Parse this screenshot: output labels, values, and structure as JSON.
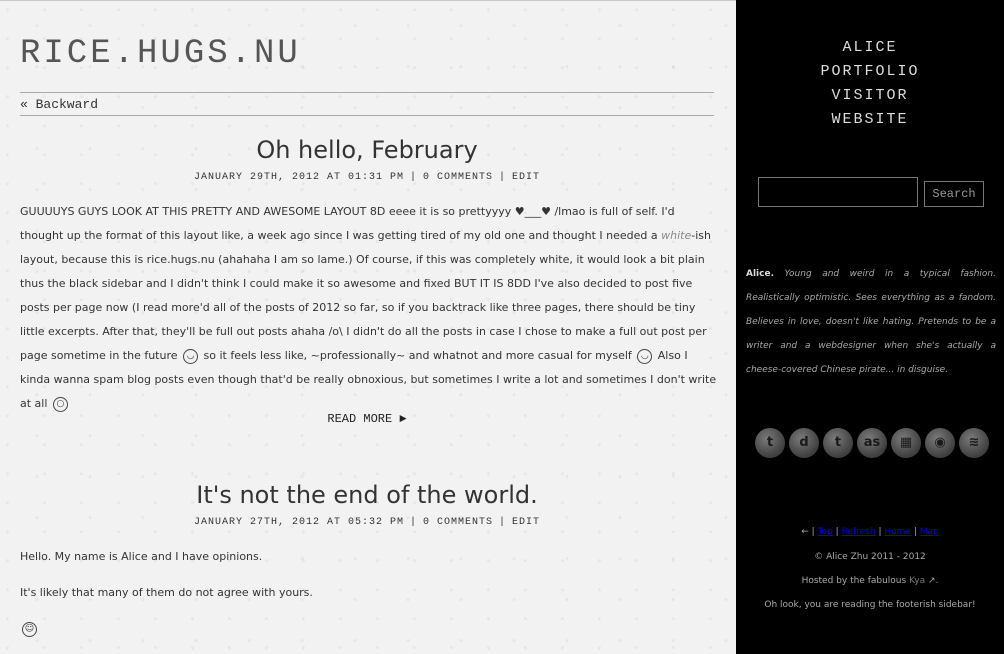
{
  "header": {
    "site_title": "RICE.HUGS.NU",
    "backward_link": "« Backward"
  },
  "posts": [
    {
      "title": "Oh hello, February",
      "date": "JANUARY 29TH, 2012 AT 01:31 PM",
      "comments": "0 COMMENTS",
      "edit": "EDIT",
      "body_part1": "GUUUUYS GUYS LOOK AT THIS PRETTY AND AWESOME LAYOUT 8D eeee it is so prettyyyy ♥___♥ /lmao is full of self. I'd thought up the format of this layout like, a week ago since I was getting tired of my old one and thought I needed a ",
      "body_em": "white",
      "body_part2": "-ish layout, because this is rice.hugs.nu (ahahaha I am so lame.) Of course, if this was completely white, it would look a bit plain thus the black sidebar and I didn't think I could make it so awesome and fixed BUT IT IS 8DD I've also decided to post five posts per page now (I read more'd all of the posts of 2012 so far, so if you backtrack like three pages, there should be tiny little excerpts. After that, they'll be full out posts ahaha /o\\ I didn't do all the posts in case I chose to make a full out post per page sometime in the future ",
      "body_part3": " so it feels less like, ~professionally~ and whatnot and more casual for myself ",
      "body_part4": " Also I kinda wanna spam blog posts even though that'd be really obnoxious, but sometimes I write a lot and sometimes I don't write at all ",
      "read_more": "READ MORE ►"
    },
    {
      "title": "It's not the end of the world.",
      "date": "JANUARY 27TH, 2012 AT 05:32 PM",
      "comments": "0 COMMENTS",
      "edit": "EDIT",
      "para1": "Hello. My name is Alice and I have opinions.",
      "para2": "It's likely that many of them do not agree with yours."
    }
  ],
  "sidebar": {
    "nav": [
      "ALICE",
      "PORTFOLIO",
      "VISITOR",
      "WEBSITE"
    ],
    "search_button": "Search",
    "about_name": "Alice.",
    "about_text": " Young and weird in a typical fashion. Realistically optimistic. Sees everything as a fandom. Believes in love, doesn't like hating. Pretends to be a writer and a webdesigner when she's actually a cheese-covered Chinese pirate... in disguise.",
    "social_icons": [
      {
        "name": "twitter-icon",
        "glyph": "t"
      },
      {
        "name": "deviantart-icon",
        "glyph": "d"
      },
      {
        "name": "tumblr-icon",
        "glyph": "t"
      },
      {
        "name": "lastfm-icon",
        "glyph": "as"
      },
      {
        "name": "windows-icon",
        "glyph": "▦"
      },
      {
        "name": "eye-icon",
        "glyph": "◉"
      },
      {
        "name": "rss-icon",
        "glyph": "≋"
      }
    ],
    "footer": {
      "arrow": "←",
      "links": [
        "Top",
        "Refresh",
        "Home",
        "Map"
      ],
      "copyright": "© Alice Zhu 2011 - 2012",
      "hosted_prefix": "Hosted by the fabulous ",
      "hosted_name": "Kya",
      "hosted_suffix": ".",
      "tagline": "Oh look, you are reading the footerish sidebar!"
    }
  }
}
